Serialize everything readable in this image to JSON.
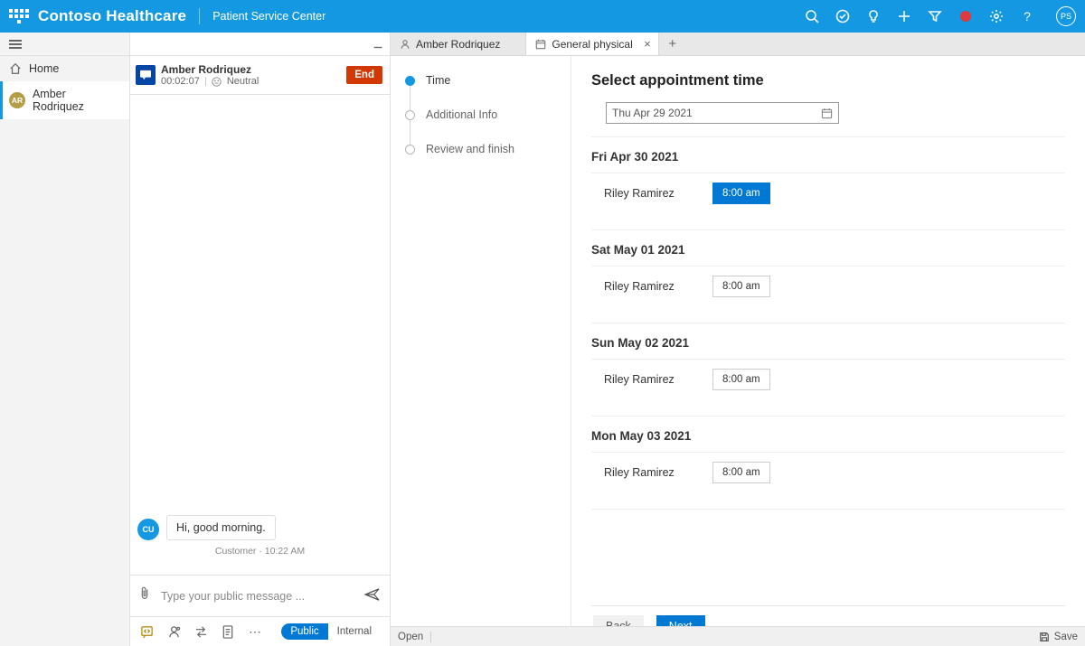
{
  "header": {
    "brand": "Contoso Healthcare",
    "subtitle": "Patient Service Center",
    "profile_initials": "PS"
  },
  "sidebar": {
    "home_label": "Home",
    "active_name": "Amber Rodriquez",
    "active_initials": "AR"
  },
  "session": {
    "name": "Amber Rodriquez",
    "timer": "00:02:07",
    "sentiment": "Neutral",
    "end_label": "End"
  },
  "chat": {
    "cu_initials": "CU",
    "message": "Hi, good morning.",
    "meta": "Customer · 10:22 AM",
    "placeholder": "Type your public message ...",
    "public_label": "Public",
    "internal_label": "Internal"
  },
  "tabs": {
    "person": "Amber Rodriquez",
    "task": "General physical"
  },
  "steps": {
    "s1": "Time",
    "s2": "Additional Info",
    "s3": "Review and finish"
  },
  "scheduler": {
    "title": "Select appointment time",
    "date_value": "Thu Apr 29 2021",
    "days": [
      {
        "label": "Fri Apr 30 2021",
        "provider": "Riley Ramirez",
        "slot": "8:00 am",
        "selected": true
      },
      {
        "label": "Sat May 01 2021",
        "provider": "Riley Ramirez",
        "slot": "8:00 am",
        "selected": false
      },
      {
        "label": "Sun May 02 2021",
        "provider": "Riley Ramirez",
        "slot": "8:00 am",
        "selected": false
      },
      {
        "label": "Mon May 03 2021",
        "provider": "Riley Ramirez",
        "slot": "8:00 am",
        "selected": false
      }
    ],
    "back_label": "Back",
    "next_label": "Next"
  },
  "status": {
    "open": "Open",
    "save": "Save"
  }
}
